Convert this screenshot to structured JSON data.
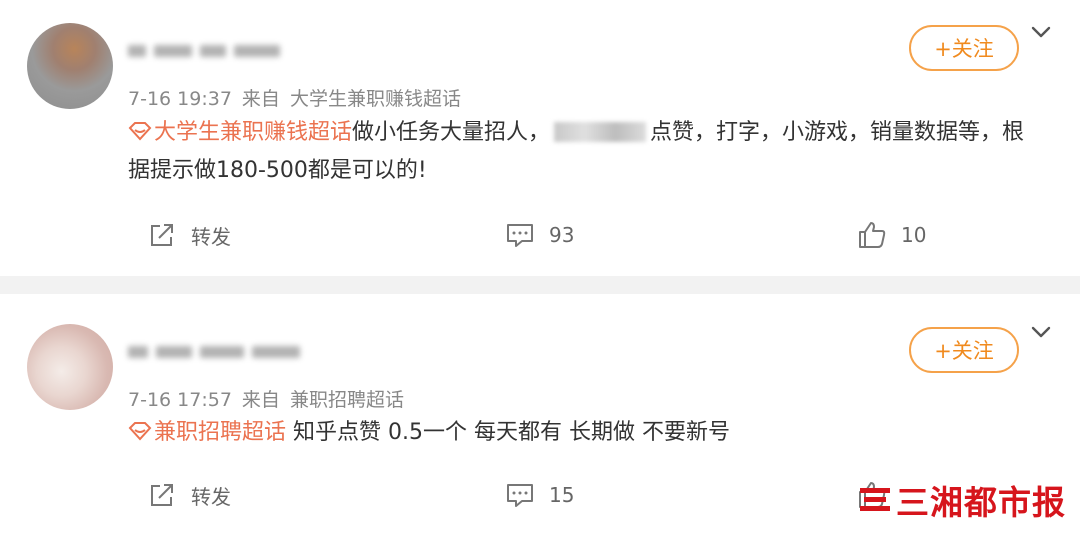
{
  "posts": [
    {
      "timestamp": "7-16 19:37",
      "source_prefix": "来自",
      "source": "大学生兼职赚钱超话",
      "follow_label": "+关注",
      "topic": "大学生兼职赚钱超话",
      "text_part1": "做小任务大量招人，",
      "text_part2": "点赞，打字，小游戏，销量数据等，根据提示做180-500都是可以的!",
      "repost_label": "转发",
      "comment_count": "93",
      "like_count": "10"
    },
    {
      "timestamp": "7-16 17:57",
      "source_prefix": "来自",
      "source": "兼职招聘超话",
      "follow_label": "+关注",
      "topic": "兼职招聘超话",
      "text": "知乎点赞 0.5一个 每天都有 长期做 不要新号",
      "repost_label": "转发",
      "comment_count": "15"
    }
  ],
  "watermark": "三湘都市报",
  "colors": {
    "topic": "#eb7350",
    "follow": "#f08a1e",
    "separator": "#f2f2f2",
    "watermark": "#d6151c"
  },
  "icons": {
    "topic": "super-topic-diamond-icon",
    "repost": "share-icon",
    "comment": "comment-icon",
    "like": "thumbs-up-icon",
    "more": "chevron-down-icon"
  }
}
